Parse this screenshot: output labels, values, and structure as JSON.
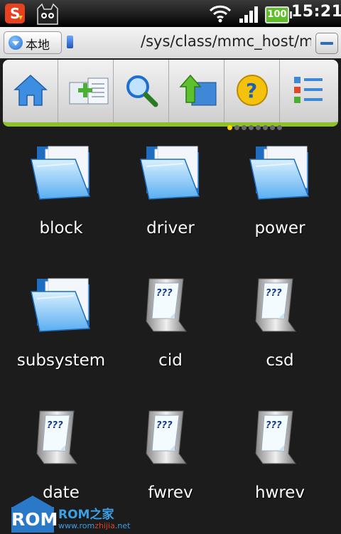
{
  "status_bar": {
    "battery": "100",
    "time": "15:21",
    "icons": [
      "sogou-input-icon",
      "cat-icon",
      "wifi-icon",
      "signal-icon",
      "battery-icon"
    ]
  },
  "path_bar": {
    "location_label": "本地",
    "path": "/sys/class/mmc_host/mm"
  },
  "toolbar": {
    "buttons": [
      {
        "name": "home",
        "icon": "home-icon"
      },
      {
        "name": "new-folder",
        "icon": "add-folder-icon"
      },
      {
        "name": "search",
        "icon": "search-icon"
      },
      {
        "name": "up",
        "icon": "up-folder-icon"
      },
      {
        "name": "help",
        "icon": "help-icon"
      },
      {
        "name": "list-view",
        "icon": "list-icon"
      }
    ],
    "pages_total": 8,
    "page_active": 1,
    "accent": "#8fc22a"
  },
  "files": [
    {
      "label": "block",
      "type": "folder"
    },
    {
      "label": "driver",
      "type": "folder"
    },
    {
      "label": "power",
      "type": "folder"
    },
    {
      "label": "subsystem",
      "type": "folder"
    },
    {
      "label": "cid",
      "type": "unknown-file"
    },
    {
      "label": "csd",
      "type": "unknown-file"
    },
    {
      "label": "date",
      "type": "unknown-file"
    },
    {
      "label": "fwrev",
      "type": "unknown-file"
    },
    {
      "label": "hwrev",
      "type": "unknown-file"
    }
  ],
  "watermark": {
    "logo": "ROM",
    "title": "ROM之家",
    "url_a": "www.rom",
    "url_b": "zhijia",
    "url_c": ".net"
  }
}
